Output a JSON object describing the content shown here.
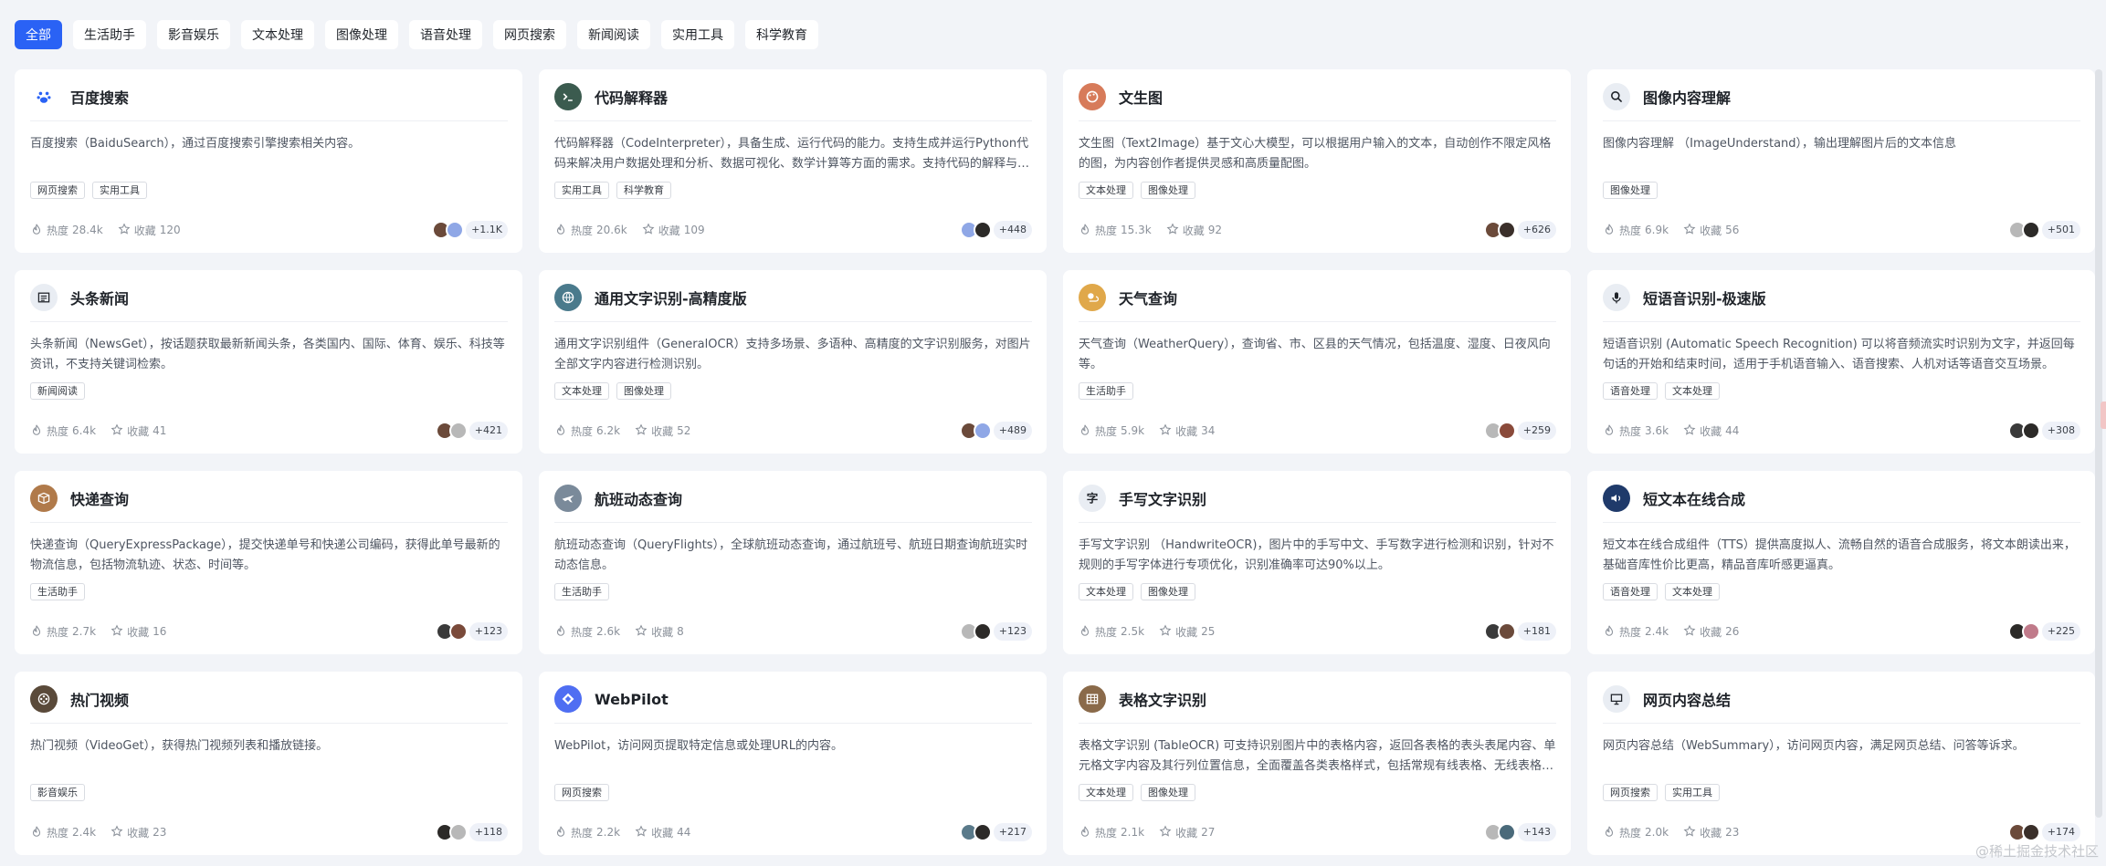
{
  "tabs": [
    "全部",
    "生活助手",
    "影音娱乐",
    "文本处理",
    "图像处理",
    "语音处理",
    "网页搜索",
    "新闻阅读",
    "实用工具",
    "科学教育"
  ],
  "active_tab": 0,
  "labels": {
    "heat": "热度",
    "fav": "收藏"
  },
  "cards": [
    {
      "title": "百度搜索",
      "desc": "百度搜索（BaiduSearch），通过百度搜索引擎搜索相关内容。",
      "tags": [
        "网页搜索",
        "实用工具"
      ],
      "heat": "28.4k",
      "fav": "120",
      "users": "+1.1K",
      "logo": "paw-icon",
      "logo_color": "#2a62f5",
      "logo_bg": "#ffffff",
      "avatars": [
        "#6b4a3a",
        "#8fa7e6"
      ]
    },
    {
      "title": "代码解释器",
      "desc": "代码解释器（CodeInterpreter），具备生成、运行代码的能力。支持生成并运行Python代码来解决用户数据处理和分析、数据可视化、数学计算等方面的需求。支持代码的解释与纠错。",
      "tags": [
        "实用工具",
        "科学教育"
      ],
      "heat": "20.6k",
      "fav": "109",
      "users": "+448",
      "logo": "terminal-icon",
      "logo_color": "#ffffff",
      "logo_bg": "#3b5b4f",
      "avatars": [
        "#8fa7e6",
        "#2c2a28"
      ]
    },
    {
      "title": "文生图",
      "desc": "文生图（Text2Image）基于文心大模型，可以根据用户输入的文本，自动创作不限定风格的图，为内容创作者提供灵感和高质量配图。",
      "tags": [
        "文本处理",
        "图像处理"
      ],
      "heat": "15.3k",
      "fav": "92",
      "users": "+626",
      "logo": "palette-icon",
      "logo_color": "#ffffff",
      "logo_bg": "#d77b5a",
      "avatars": [
        "#6b4a3a",
        "#3a2f2a"
      ]
    },
    {
      "title": "图像内容理解",
      "desc": "图像内容理解 （ImageUnderstand），输出理解图片后的文本信息",
      "tags": [
        "图像处理"
      ],
      "heat": "6.9k",
      "fav": "56",
      "users": "+501",
      "logo": "magnifier-icon",
      "logo_color": "#1f2329",
      "logo_bg": "#e9edf3",
      "avatars": [
        "#b8b8b8",
        "#2c2a28"
      ]
    },
    {
      "title": "头条新闻",
      "desc": "头条新闻（NewsGet），按话题获取最新新闻头条，各类国内、国际、体育、娱乐、科技等资讯，不支持关键词检索。",
      "tags": [
        "新闻阅读"
      ],
      "heat": "6.4k",
      "fav": "41",
      "users": "+421",
      "logo": "newspaper-icon",
      "logo_color": "#1f2329",
      "logo_bg": "#e9edf3",
      "avatars": [
        "#6b4a3a",
        "#b8b8b8"
      ]
    },
    {
      "title": "通用文字识别-高精度版",
      "desc": "通用文字识别组件（GeneralOCR）支持多场景、多语种、高精度的文字识别服务，对图片全部文字内容进行检测识别。",
      "tags": [
        "文本处理",
        "图像处理"
      ],
      "heat": "6.2k",
      "fav": "52",
      "users": "+489",
      "logo": "globe-icon",
      "logo_color": "#ffffff",
      "logo_bg": "#4a7a8c",
      "avatars": [
        "#6b4a3a",
        "#8fa7e6"
      ]
    },
    {
      "title": "天气查询",
      "desc": "天气查询（WeatherQuery），查询省、市、区县的天气情况，包括温度、湿度、日夜风向等。",
      "tags": [
        "生活助手"
      ],
      "heat": "5.9k",
      "fav": "34",
      "users": "+259",
      "logo": "weather-icon",
      "logo_color": "#ffffff",
      "logo_bg": "#e0a84a",
      "avatars": [
        "#b8b8b8",
        "#8a4a3a"
      ]
    },
    {
      "title": "短语音识别-极速版",
      "desc": "短语音识别 (Automatic Speech Recognition) 可以将音频流实时识别为文字，并返回每句话的开始和结束时间，适用于手机语音输入、语音搜索、人机对话等语音交互场景。",
      "tags": [
        "语音处理",
        "文本处理"
      ],
      "heat": "3.6k",
      "fav": "44",
      "users": "+308",
      "logo": "microphone-icon",
      "logo_color": "#1f2329",
      "logo_bg": "#e9edf3",
      "avatars": [
        "#3a3a3a",
        "#2c2a28"
      ]
    },
    {
      "title": "快递查询",
      "desc": "快递查询（QueryExpressPackage），提交快递单号和快递公司编码，获得此单号最新的物流信息，包括物流轨迹、状态、时间等。",
      "tags": [
        "生活助手"
      ],
      "heat": "2.7k",
      "fav": "16",
      "users": "+123",
      "logo": "package-icon",
      "logo_color": "#ffffff",
      "logo_bg": "#b07a4a",
      "avatars": [
        "#3a3a3a",
        "#7a4a3a"
      ]
    },
    {
      "title": "航班动态查询",
      "desc": "航班动态查询（QueryFlights），全球航班动态查询，通过航班号、航班日期查询航班实时动态信息。",
      "tags": [
        "生活助手"
      ],
      "heat": "2.6k",
      "fav": "8",
      "users": "+123",
      "logo": "airplane-icon",
      "logo_color": "#ffffff",
      "logo_bg": "#7a8a9a",
      "avatars": [
        "#b8b8b8",
        "#2c2a28"
      ]
    },
    {
      "title": "手写文字识别",
      "desc": "手写文字识别 （HandwriteOCR)，图片中的手写中文、手写数字进行检测和识别，针对不规则的手写字体进行专项优化，识别准确率可达90%以上。",
      "tags": [
        "文本处理",
        "图像处理"
      ],
      "heat": "2.5k",
      "fav": "25",
      "users": "+181",
      "logo": "handwriting-icon",
      "logo_color": "#1f2329",
      "logo_bg": "#e9edf3",
      "avatars": [
        "#3a3a3a",
        "#6b4a3a"
      ]
    },
    {
      "title": "短文本在线合成",
      "desc": "短文本在线合成组件（TTS）提供高度拟人、流畅自然的语音合成服务，将文本朗读出来，基础音库性价比更高，精品音库听感更逼真。",
      "tags": [
        "语音处理",
        "文本处理"
      ],
      "heat": "2.4k",
      "fav": "26",
      "users": "+225",
      "logo": "speaker-icon",
      "logo_color": "#ffffff",
      "logo_bg": "#1f3a6a",
      "avatars": [
        "#2c2a28",
        "#c07a8a"
      ]
    },
    {
      "title": "热门视频",
      "desc": "热门视频（VideoGet），获得热门视频列表和播放链接。",
      "tags": [
        "影音娱乐"
      ],
      "heat": "2.4k",
      "fav": "23",
      "users": "+118",
      "logo": "film-icon",
      "logo_color": "#ffffff",
      "logo_bg": "#5a4a3a",
      "avatars": [
        "#2c2a28",
        "#b8b8b8"
      ]
    },
    {
      "title": "WebPilot",
      "desc": "WebPilot，访问网页提取特定信息或处理URL的内容。",
      "tags": [
        "网页搜索"
      ],
      "heat": "2.2k",
      "fav": "44",
      "users": "+217",
      "logo": "compass-icon",
      "logo_color": "#ffffff",
      "logo_bg": "#4f6ef2",
      "avatars": [
        "#5a7a8a",
        "#2c2a28"
      ]
    },
    {
      "title": "表格文字识别",
      "desc": "表格文字识别 (TableOCR) 可支持识别图片中的表格内容，返回各表格的表头表尾内容、单元格文字内容及其行列位置信息，全面覆盖各类表格样式，包括常规有线表格、无线表格、含合并单元格表格。",
      "tags": [
        "文本处理",
        "图像处理"
      ],
      "heat": "2.1k",
      "fav": "27",
      "users": "+143",
      "logo": "table-icon",
      "logo_color": "#ffffff",
      "logo_bg": "#8a6a4a",
      "avatars": [
        "#b8b8b8",
        "#4a6a7a"
      ]
    },
    {
      "title": "网页内容总结",
      "desc": "网页内容总结（WebSummary），访问网页内容，满足网页总结、问答等诉求。",
      "tags": [
        "网页搜索",
        "实用工具"
      ],
      "heat": "2.0k",
      "fav": "23",
      "users": "+174",
      "logo": "monitor-icon",
      "logo_color": "#1f2329",
      "logo_bg": "#e9edf3",
      "avatars": [
        "#6b4a3a",
        "#3a2f2a"
      ]
    }
  ],
  "watermark": "@稀土掘金技术社区"
}
